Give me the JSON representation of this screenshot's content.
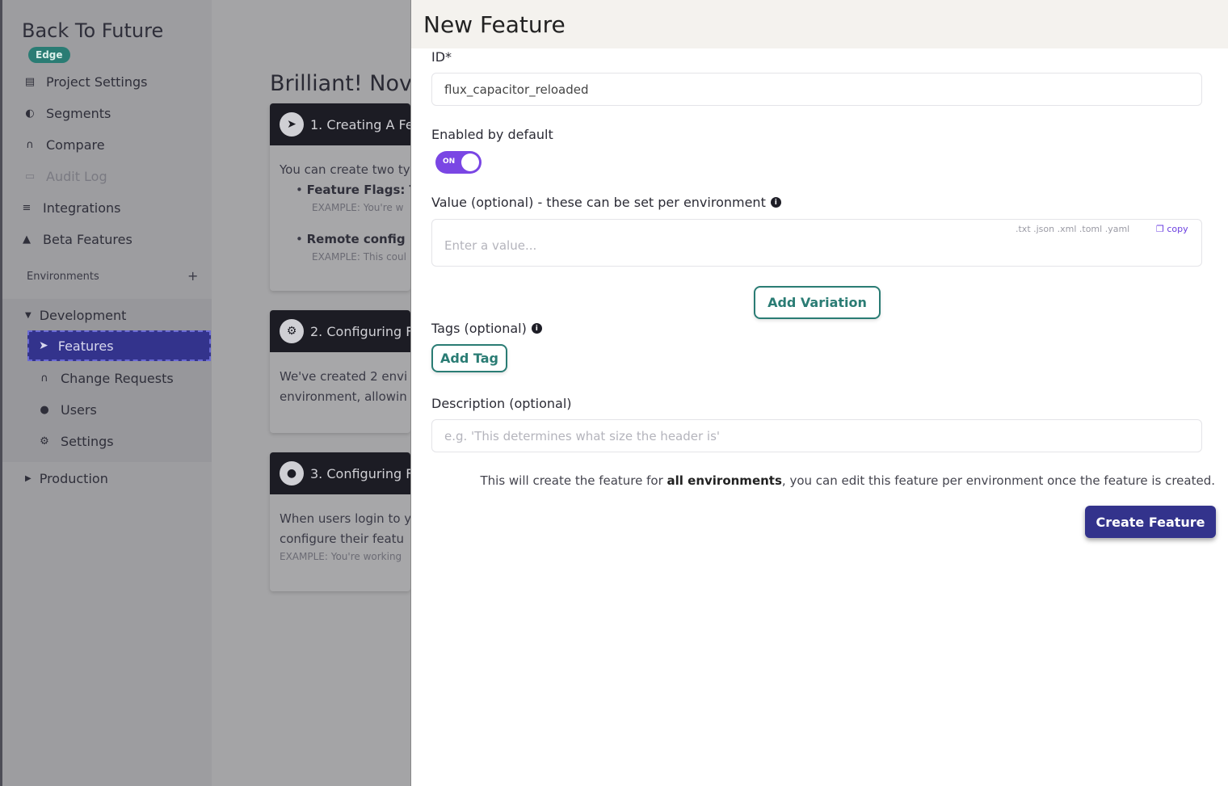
{
  "sidebar": {
    "project_title": "Back To Future",
    "badge": "Edge",
    "items": [
      {
        "label": "Project Settings",
        "icon": "project-settings-icon"
      },
      {
        "label": "Segments",
        "icon": "segments-icon"
      },
      {
        "label": "Compare",
        "icon": "compare-icon"
      },
      {
        "label": "Audit Log",
        "icon": "audit-log-icon",
        "disabled": true
      },
      {
        "label": "Integrations",
        "icon": "integrations-icon"
      },
      {
        "label": "Beta Features",
        "icon": "beta-features-icon"
      }
    ],
    "environments_label": "Environments",
    "add_symbol": "+",
    "environments": [
      {
        "name": "Development",
        "expanded": true,
        "items": [
          {
            "label": "Features",
            "icon": "rocket-icon",
            "active": true
          },
          {
            "label": "Change Requests",
            "icon": "change-requests-icon"
          },
          {
            "label": "Users",
            "icon": "users-icon"
          },
          {
            "label": "Settings",
            "icon": "settings-icon"
          }
        ]
      },
      {
        "name": "Production",
        "expanded": false
      }
    ]
  },
  "main": {
    "title": "Brilliant! Nov",
    "steps": [
      {
        "title": "1. Creating A Fe",
        "icon": "rocket-icon",
        "lines": [
          {
            "text": "You can create two ty",
            "kind": "text"
          },
          {
            "text": "Feature Flags: T",
            "kind": "bullet"
          },
          {
            "text": "EXAMPLE: You're w",
            "kind": "example"
          },
          {
            "text": "Remote config",
            "kind": "bullet"
          },
          {
            "text": "EXAMPLE: This coul",
            "kind": "example"
          }
        ]
      },
      {
        "title": "2. Configuring F",
        "icon": "gear-icon",
        "lines": [
          {
            "text": "We've created 2 envi",
            "kind": "text"
          },
          {
            "text": "environment, allowin",
            "kind": "text"
          }
        ]
      },
      {
        "title": "3. Configuring F",
        "icon": "user-icon",
        "lines": [
          {
            "text": "When users login to y",
            "kind": "text"
          },
          {
            "text": "configure their featu",
            "kind": "text"
          },
          {
            "text": "EXAMPLE: You're working",
            "kind": "example"
          }
        ]
      }
    ]
  },
  "modal": {
    "title": "New Feature",
    "id_label": "ID*",
    "id_value": "flux_capacitor_reloaded",
    "enabled_label": "Enabled by default",
    "toggle_text": "ON",
    "value_label": "Value (optional) - these can be set per environment",
    "value_placeholder": "Enter a value...",
    "value_formats": ".txt  .json  .xml  .toml  .yaml",
    "copy_label": "copy",
    "add_variation": "Add Variation",
    "tags_label": "Tags (optional)",
    "add_tag": "Add Tag",
    "description_label": "Description (optional)",
    "description_placeholder": "e.g. 'This determines what size the header is'",
    "info_prefix": "This will create the feature for ",
    "info_bold": "all environments",
    "info_suffix": ", you can edit this feature per environment once the feature is created.",
    "create_button": "Create Feature"
  },
  "colors": {
    "primary": "#33338c",
    "teal": "#2a7c74",
    "toggle": "#7a46e4"
  }
}
